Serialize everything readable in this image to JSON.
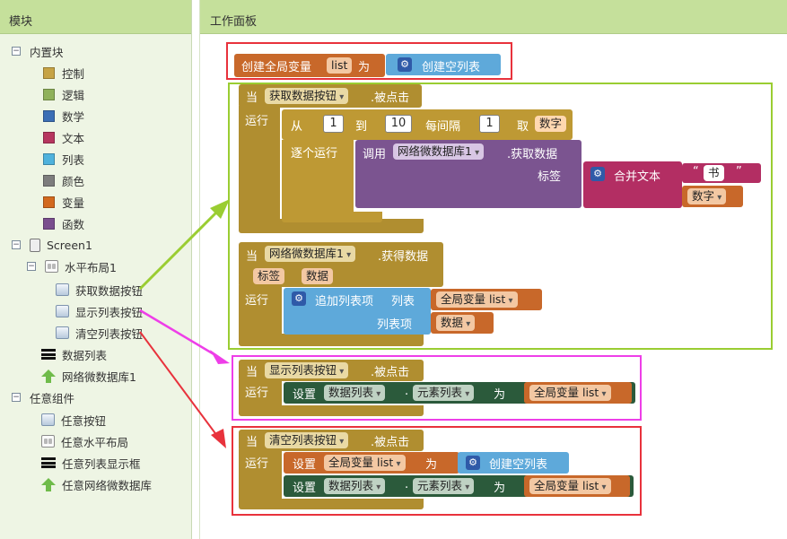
{
  "left_panel": {
    "title": "模块",
    "builtin": {
      "label": "内置块",
      "items": [
        {
          "label": "控制",
          "color": "#c6a345"
        },
        {
          "label": "逻辑",
          "color": "#8fb15a"
        },
        {
          "label": "数学",
          "color": "#3b6eb5"
        },
        {
          "label": "文本",
          "color": "#b6365f"
        },
        {
          "label": "列表",
          "color": "#4fb2dc"
        },
        {
          "label": "颜色",
          "color": "#7d7d7d"
        },
        {
          "label": "变量",
          "color": "#d2691e"
        },
        {
          "label": "函数",
          "color": "#7a4e8e"
        }
      ]
    },
    "screen": {
      "label": "Screen1",
      "arrangement": {
        "label": "水平布局1",
        "children": [
          "获取数据按钮",
          "显示列表按钮",
          "清空列表按钮"
        ]
      },
      "components": [
        "数据列表",
        "网络微数据库1"
      ]
    },
    "any_components": {
      "label": "任意组件",
      "items": [
        "任意按钮",
        "任意水平布局",
        "任意列表显示框",
        "任意网络微数据库"
      ]
    }
  },
  "workspace": {
    "title": "工作面板",
    "global_var": {
      "init_label": "创建全局变量",
      "name": "list",
      "to": "为",
      "value_label": "创建空列表"
    },
    "fetch_click": {
      "when": "当",
      "component": "获取数据按钮",
      "event": ".被点击",
      "do": "运行",
      "for_from": "从",
      "from": "1",
      "to_label": "到",
      "to": "10",
      "step_label": "每间隔",
      "step": "1",
      "take": "取",
      "var": "数字",
      "each_do": "逐个运行",
      "call": "调用",
      "db": "网络微数据库1",
      "method": ".获取数据",
      "tag_label": "标签",
      "join": "合并文本",
      "str": "书",
      "join_var": "数字"
    },
    "got_value": {
      "when": "当",
      "component": "网络微数据库1",
      "event": ".获得数据",
      "param_tag": "标签",
      "param_value": "数据",
      "do": "运行",
      "add_items": "追加列表项",
      "list_label": "列表",
      "global_var": "全局变量 list",
      "item_label": "列表项",
      "item_var": "数据"
    },
    "show_click": {
      "when": "当",
      "component": "显示列表按钮",
      "event": ".被点击",
      "do": "运行",
      "set": "设置",
      "target": "数据列表",
      "dot": ".",
      "prop": "元素列表",
      "to": "为",
      "value": "全局变量 list"
    },
    "clear_click": {
      "when": "当",
      "component": "清空列表按钮",
      "event": ".被点击",
      "do": "运行",
      "set1": "设置",
      "var": "全局变量 list",
      "to1": "为",
      "empty": "创建空列表",
      "set2": "设置",
      "target": "数据列表",
      "dot": ".",
      "prop": "元素列表",
      "to2": "为",
      "value": "全局变量 list"
    },
    "annotations": {
      "red": "#e8323c",
      "green": "#9acd32",
      "magenta": "#ee3ee8"
    }
  }
}
